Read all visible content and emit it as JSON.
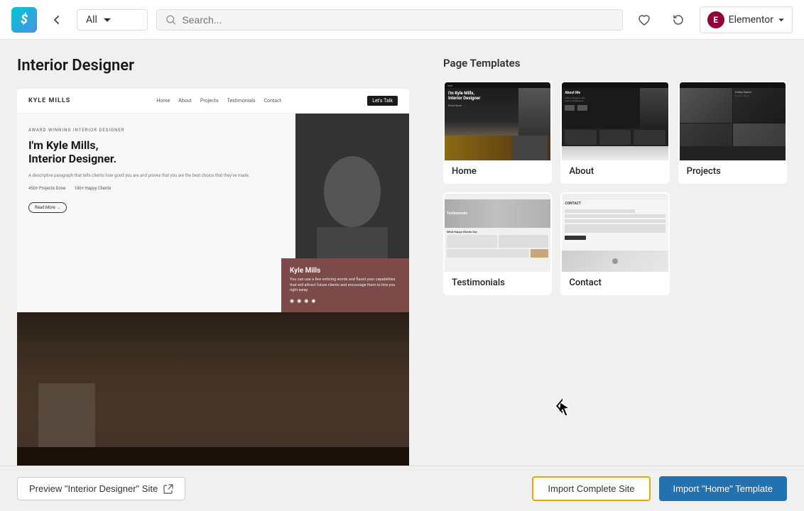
{
  "topbar": {
    "logo_text": "S",
    "filter_label": "All",
    "search_placeholder": "Search...",
    "elementor_label": "Elementor"
  },
  "site": {
    "title": "Interior Designer"
  },
  "preview": {
    "nav_logo": "KYLE MILLS",
    "nav_links": [
      "Home",
      "About",
      "Projects",
      "Testimonials",
      "Contact"
    ],
    "nav_cta": "Let's Talk",
    "hero_label": "AWARD WINNING INTERIOR DESIGNER",
    "hero_title": "I'm Kyle Mills,\nInterior Designer.",
    "hero_text": "A descriptive paragraph that tells clients how good you are and proves that you are the best choice that they've made.",
    "stat1": "450+ Projects Done",
    "stat2": "100+ Happy Clients",
    "hero_cta": "Read More →",
    "bio_name": "Kyle Mills",
    "bio_text": "You can use a few enticing words and flaunt your capabilities that will attract future clients and encourage them to hire you right away."
  },
  "page_templates": {
    "title": "Page Templates",
    "templates": [
      {
        "id": "home",
        "label": "Home"
      },
      {
        "id": "about",
        "label": "About"
      },
      {
        "id": "projects",
        "label": "Projects"
      },
      {
        "id": "testimonials",
        "label": "Testimonials"
      },
      {
        "id": "contact",
        "label": "Contact"
      }
    ]
  },
  "footer": {
    "preview_btn": "Preview \"Interior Designer\" Site",
    "import_complete_btn": "Import Complete Site",
    "import_home_btn": "Import \"Home\" Template"
  }
}
